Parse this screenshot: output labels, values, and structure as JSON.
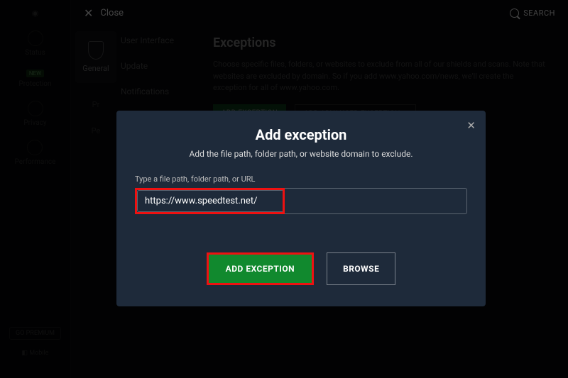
{
  "topbar": {
    "close": "Close",
    "search": "SEARCH"
  },
  "leftnav": {
    "items": [
      "Status",
      "Protection",
      "Privacy",
      "Performance"
    ],
    "premium": "GO PREMIUM",
    "mobile": "Mobile"
  },
  "sidecol": {
    "general": "General",
    "pr": "Pr",
    "pe": "Pe"
  },
  "menu": {
    "items": [
      "User Interface",
      "Update",
      "Notifications"
    ]
  },
  "main": {
    "title": "Exceptions",
    "desc": "Choose specific files, folders, or websites to exclude from all of our shields and scans. Note that websites are excluded by domain. So if you add www.yahoo.com/news, we'll create the exception for all of www.yahoo.com.",
    "add": "ADD EXCEPTION",
    "addAdvanced": "ADD ADVANCED EXCEPTION"
  },
  "modal": {
    "title": "Add exception",
    "subtitle": "Add the file path, folder path, or website domain to exclude.",
    "label": "Type a file path, folder path, or URL",
    "value": "https://www.speedtest.net/",
    "primary": "ADD EXCEPTION",
    "secondary": "BROWSE"
  }
}
